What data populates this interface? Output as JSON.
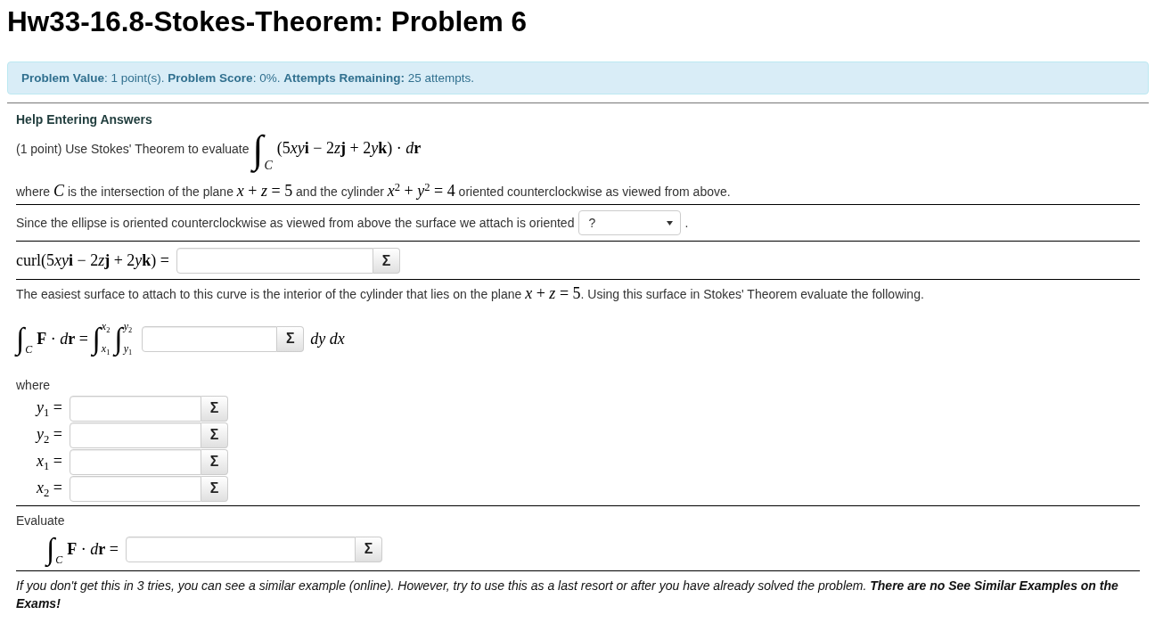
{
  "title": "Hw33-16.8-Stokes-Theorem: Problem 6",
  "info": "**Problem Value**: 1 point(s). **Problem Score**: 0%. **Attempts Remaining:** 25 attempts.",
  "help_link": "Help Entering Answers",
  "statement": [
    {
      "kind": "text",
      "text": "(1 point) Use Stokes' Theorem to evaluate "
    },
    {
      "kind": "math",
      "tokens": [
        {
          "kind": "integral",
          "text": "∫",
          "lower": [
            {
              "kind": "var",
              "text": "C"
            }
          ]
        },
        {
          "kind": "roman",
          "text": "(5"
        },
        {
          "kind": "var",
          "text": "xy"
        },
        {
          "kind": "vec",
          "text": "i"
        },
        {
          "kind": "roman",
          "text": " − 2"
        },
        {
          "kind": "var",
          "text": "z"
        },
        {
          "kind": "vec",
          "text": "j"
        },
        {
          "kind": "roman",
          "text": " + 2"
        },
        {
          "kind": "var",
          "text": "y"
        },
        {
          "kind": "vec",
          "text": "k"
        },
        {
          "kind": "roman",
          "text": ") · "
        },
        {
          "kind": "var",
          "text": "d"
        },
        {
          "kind": "vec",
          "text": "r"
        }
      ]
    }
  ],
  "condition": [
    {
      "kind": "text",
      "text": "where "
    },
    {
      "kind": "math",
      "tokens": [
        {
          "kind": "var",
          "text": "C"
        }
      ]
    },
    {
      "kind": "text",
      "text": " is the intersection of the plane "
    },
    {
      "kind": "math",
      "tokens": [
        {
          "kind": "var",
          "text": "x"
        },
        {
          "kind": "roman",
          "text": " + "
        },
        {
          "kind": "var",
          "text": "z"
        },
        {
          "kind": "roman",
          "text": " = 5"
        }
      ]
    },
    {
      "kind": "text",
      "text": " and the cylinder "
    },
    {
      "kind": "math",
      "tokens": [
        {
          "kind": "var",
          "text": "x"
        },
        {
          "kind": "sup",
          "text": "2"
        },
        {
          "kind": "roman",
          "text": " + "
        },
        {
          "kind": "var",
          "text": "y"
        },
        {
          "kind": "sup",
          "text": "2"
        },
        {
          "kind": "roman",
          "text": " = 4"
        }
      ]
    },
    {
      "kind": "text",
      "text": " oriented counterclockwise as viewed from above."
    }
  ],
  "orientation": {
    "text": "Since the ellipse is oriented counterclockwise as viewed from above the surface we attach is oriented",
    "select": "?",
    "after": "."
  },
  "curl": {
    "label": [
      {
        "kind": "roman",
        "text": "curl(5"
      },
      {
        "kind": "var",
        "text": "xy"
      },
      {
        "kind": "vec",
        "text": "i"
      },
      {
        "kind": "roman",
        "text": " − 2"
      },
      {
        "kind": "var",
        "text": "z"
      },
      {
        "kind": "vec",
        "text": "j"
      },
      {
        "kind": "roman",
        "text": " + 2"
      },
      {
        "kind": "var",
        "text": "y"
      },
      {
        "kind": "vec",
        "text": "k"
      },
      {
        "kind": "roman",
        "text": ") ="
      }
    ],
    "button": "Σ"
  },
  "surface_text": [
    {
      "kind": "text",
      "text": "The easiest surface to attach to this curve is the interior of the cylinder that lies on the plane "
    },
    {
      "kind": "math",
      "tokens": [
        {
          "kind": "var",
          "text": "x"
        },
        {
          "kind": "roman",
          "text": " + "
        },
        {
          "kind": "var",
          "text": "z"
        },
        {
          "kind": "roman",
          "text": " = 5"
        }
      ]
    },
    {
      "kind": "text",
      "text": ". Using this surface in Stokes' Theorem evaluate the following."
    }
  ],
  "surface_integral": {
    "label": [
      {
        "kind": "integral",
        "text": "∫",
        "lower": [
          {
            "kind": "var",
            "text": "C"
          }
        ]
      },
      {
        "kind": "vec",
        "text": "F"
      },
      {
        "kind": "roman",
        "text": " · "
      },
      {
        "kind": "var",
        "text": "d"
      },
      {
        "kind": "vec",
        "text": "r"
      },
      {
        "kind": "roman",
        "text": " = "
      },
      {
        "kind": "integral",
        "text": "∫",
        "lower": [
          {
            "kind": "var",
            "text": "x"
          },
          {
            "kind": "sub",
            "text": "1"
          }
        ],
        "upper": [
          {
            "kind": "var",
            "text": "x"
          },
          {
            "kind": "sub",
            "text": "2"
          }
        ]
      },
      {
        "kind": "integral",
        "text": "∫",
        "lower": [
          {
            "kind": "var",
            "text": "y"
          },
          {
            "kind": "sub",
            "text": "1"
          }
        ],
        "upper": [
          {
            "kind": "var",
            "text": "y"
          },
          {
            "kind": "sub",
            "text": "2"
          }
        ]
      }
    ],
    "button": "Σ",
    "after": [
      {
        "kind": "var",
        "text": "dy dx"
      }
    ]
  },
  "where": "where",
  "bounds": [
    {
      "label": [
        {
          "kind": "var",
          "text": "y"
        },
        {
          "kind": "sub",
          "text": "1"
        },
        {
          "kind": "roman",
          "text": " ="
        }
      ],
      "button": "Σ"
    },
    {
      "label": [
        {
          "kind": "var",
          "text": "y"
        },
        {
          "kind": "sub",
          "text": "2"
        },
        {
          "kind": "roman",
          "text": " ="
        }
      ],
      "button": "Σ"
    },
    {
      "label": [
        {
          "kind": "var",
          "text": "x"
        },
        {
          "kind": "sub",
          "text": "1"
        },
        {
          "kind": "roman",
          "text": " ="
        }
      ],
      "button": "Σ"
    },
    {
      "label": [
        {
          "kind": "var",
          "text": "x"
        },
        {
          "kind": "sub",
          "text": "2"
        },
        {
          "kind": "roman",
          "text": " ="
        }
      ],
      "button": "Σ"
    }
  ],
  "evaluate_label": "Evaluate",
  "evaluate": {
    "label": [
      {
        "kind": "integral",
        "text": "∫",
        "lower": [
          {
            "kind": "var",
            "text": "C"
          }
        ]
      },
      {
        "kind": "vec",
        "text": "F"
      },
      {
        "kind": "roman",
        "text": " · "
      },
      {
        "kind": "var",
        "text": "d"
      },
      {
        "kind": "vec",
        "text": "r"
      },
      {
        "kind": "roman",
        "text": " ="
      }
    ],
    "button": "Σ"
  },
  "note": "If you don't get this in 3 tries, you can see a similar example (online). However, try to use this as a last resort or after you have already solved the problem. **There are no See Similar Examples on the Exams!**"
}
